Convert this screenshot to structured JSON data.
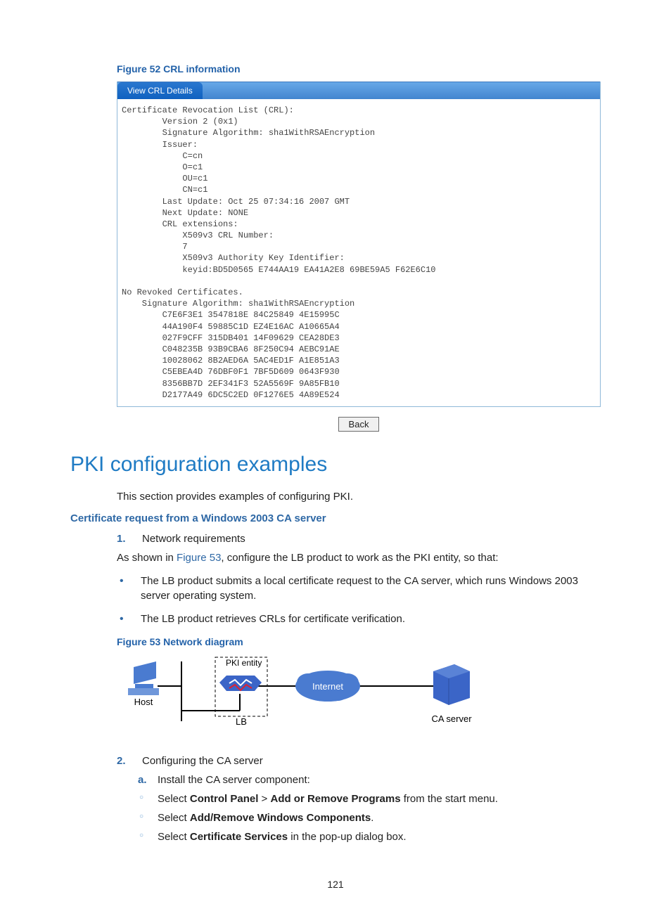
{
  "figure52": {
    "caption": "Figure 52 CRL information",
    "tab_label": "View CRL Details",
    "crl_text": "Certificate Revocation List (CRL):\n        Version 2 (0x1)\n        Signature Algorithm: sha1WithRSAEncryption\n        Issuer:\n            C=cn\n            O=c1\n            OU=c1\n            CN=c1\n        Last Update: Oct 25 07:34:16 2007 GMT\n        Next Update: NONE\n        CRL extensions:\n            X509v3 CRL Number:\n            7\n            X509v3 Authority Key Identifier:\n            keyid:BD5D0565 E744AA19 EA41A2E8 69BE59A5 F62E6C10\n\nNo Revoked Certificates.\n    Signature Algorithm: sha1WithRSAEncryption\n        C7E6F3E1 3547818E 84C25849 4E15995C\n        44A190F4 59885C1D EZ4E16AC A10665A4\n        027F9CFF 315DB401 14F09629 CEA28DE3\n        C048235B 93B9CBA6 8F250C94 AEBC91AE\n        10028062 8B2AED6A 5AC4ED1F A1E851A3\n        C5EBEA4D 76DBF0F1 7BF5D609 0643F930\n        8356BB7D 2EF341F3 52A5569F 9A85FB10\n        D2177A49 6DC5C2ED 0F1276E5 4A89E524",
    "back_button": "Back"
  },
  "section_title": "PKI configuration examples",
  "intro_text": "This section provides examples of configuring PKI.",
  "subheading": "Certificate request from a Windows 2003 CA server",
  "step1": {
    "num": "1.",
    "label": "Network requirements"
  },
  "para_as_shown_pre": "As shown in ",
  "para_as_shown_link": "Figure 53",
  "para_as_shown_post": ", configure the LB product to work as the PKI entity, so that:",
  "bullet1": "The LB product submits a local certificate request to the CA server, which runs Windows 2003 server operating system.",
  "bullet2": "The LB product retrieves CRLs for certificate verification.",
  "figure53": {
    "caption": "Figure 53 Network diagram",
    "labels": {
      "host": "Host",
      "pki_entity": "PKI entity",
      "lb": "LB",
      "internet": "Internet",
      "ca_server": "CA server"
    }
  },
  "step2": {
    "num": "2.",
    "label": "Configuring the CA server"
  },
  "step2a": {
    "letter": "a.",
    "text": "Install the CA server component:"
  },
  "sub1_pre": "Select ",
  "sub1_b1": "Control Panel",
  "sub1_mid": " > ",
  "sub1_b2": "Add or Remove Programs",
  "sub1_post": " from the start menu.",
  "sub2_pre": "Select ",
  "sub2_b": "Add/Remove Windows Components",
  "sub2_post": ".",
  "sub3_pre": "Select ",
  "sub3_b": "Certificate Services",
  "sub3_post": " in the pop-up dialog box.",
  "page_number": "121"
}
